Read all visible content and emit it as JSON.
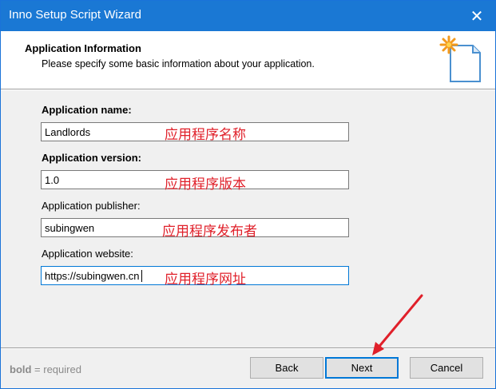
{
  "window": {
    "title": "Inno Setup Script Wizard",
    "close_glyph": "✕"
  },
  "header": {
    "title": "Application Information",
    "subtitle": "Please specify some basic information about your application."
  },
  "form": {
    "name": {
      "label": "Application name:",
      "value": "Landlords",
      "annotation": "应用程序名称"
    },
    "version": {
      "label": "Application version:",
      "value": "1.0",
      "annotation": "应用程序版本"
    },
    "publisher": {
      "label": "Application publisher:",
      "value": "subingwen",
      "annotation": "应用程序发布者"
    },
    "website": {
      "label": "Application website:",
      "value": "https://subingwen.cn",
      "annotation": "应用程序网址"
    }
  },
  "footer": {
    "bold_word": "bold",
    "bold_rest": " = required",
    "back": "Back",
    "next": "Next",
    "cancel": "Cancel"
  },
  "colors": {
    "titlebar": "#1a78d4",
    "annotation": "#e0202a",
    "focus_border": "#0078d7"
  },
  "icons": {
    "header": "wizard-page-icon",
    "close": "close-icon",
    "arrow": "red-arrow-annotation"
  }
}
